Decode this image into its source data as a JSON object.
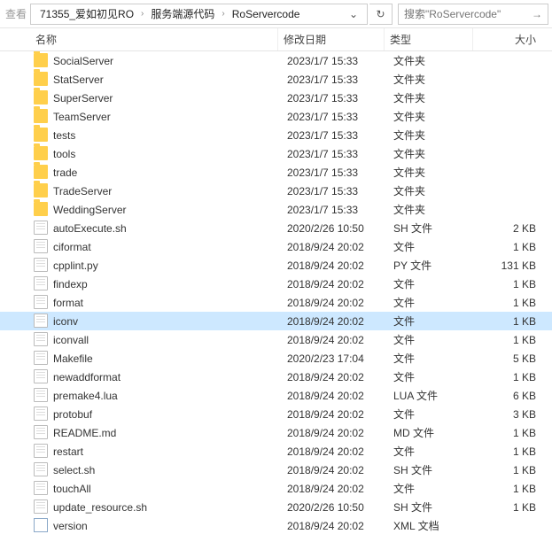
{
  "toolbar": {
    "back_label": "查看",
    "breadcrumb": [
      "71355_爱如初见RO",
      "服务端源代码",
      "RoServercode"
    ],
    "search_placeholder": "搜索\"RoServercode\""
  },
  "columns": {
    "name": "名称",
    "modified": "修改日期",
    "type": "类型",
    "size": "大小"
  },
  "files": [
    {
      "icon": "folder",
      "name": "SocialServer",
      "modified": "2023/1/7 15:33",
      "type": "文件夹",
      "size": ""
    },
    {
      "icon": "folder",
      "name": "StatServer",
      "modified": "2023/1/7 15:33",
      "type": "文件夹",
      "size": ""
    },
    {
      "icon": "folder",
      "name": "SuperServer",
      "modified": "2023/1/7 15:33",
      "type": "文件夹",
      "size": ""
    },
    {
      "icon": "folder",
      "name": "TeamServer",
      "modified": "2023/1/7 15:33",
      "type": "文件夹",
      "size": ""
    },
    {
      "icon": "folder",
      "name": "tests",
      "modified": "2023/1/7 15:33",
      "type": "文件夹",
      "size": ""
    },
    {
      "icon": "folder",
      "name": "tools",
      "modified": "2023/1/7 15:33",
      "type": "文件夹",
      "size": ""
    },
    {
      "icon": "folder",
      "name": "trade",
      "modified": "2023/1/7 15:33",
      "type": "文件夹",
      "size": ""
    },
    {
      "icon": "folder",
      "name": "TradeServer",
      "modified": "2023/1/7 15:33",
      "type": "文件夹",
      "size": ""
    },
    {
      "icon": "folder",
      "name": "WeddingServer",
      "modified": "2023/1/7 15:33",
      "type": "文件夹",
      "size": ""
    },
    {
      "icon": "file",
      "name": "autoExecute.sh",
      "modified": "2020/2/26 10:50",
      "type": "SH 文件",
      "size": "2 KB"
    },
    {
      "icon": "file",
      "name": "ciformat",
      "modified": "2018/9/24 20:02",
      "type": "文件",
      "size": "1 KB"
    },
    {
      "icon": "file",
      "name": "cpplint.py",
      "modified": "2018/9/24 20:02",
      "type": "PY 文件",
      "size": "131 KB"
    },
    {
      "icon": "file",
      "name": "findexp",
      "modified": "2018/9/24 20:02",
      "type": "文件",
      "size": "1 KB"
    },
    {
      "icon": "file",
      "name": "format",
      "modified": "2018/9/24 20:02",
      "type": "文件",
      "size": "1 KB"
    },
    {
      "icon": "file",
      "name": "iconv",
      "modified": "2018/9/24 20:02",
      "type": "文件",
      "size": "1 KB",
      "selected": true
    },
    {
      "icon": "file",
      "name": "iconvall",
      "modified": "2018/9/24 20:02",
      "type": "文件",
      "size": "1 KB"
    },
    {
      "icon": "file",
      "name": "Makefile",
      "modified": "2020/2/23 17:04",
      "type": "文件",
      "size": "5 KB"
    },
    {
      "icon": "file",
      "name": "newaddformat",
      "modified": "2018/9/24 20:02",
      "type": "文件",
      "size": "1 KB"
    },
    {
      "icon": "file",
      "name": "premake4.lua",
      "modified": "2018/9/24 20:02",
      "type": "LUA 文件",
      "size": "6 KB"
    },
    {
      "icon": "file",
      "name": "protobuf",
      "modified": "2018/9/24 20:02",
      "type": "文件",
      "size": "3 KB"
    },
    {
      "icon": "file",
      "name": "README.md",
      "modified": "2018/9/24 20:02",
      "type": "MD 文件",
      "size": "1 KB"
    },
    {
      "icon": "file",
      "name": "restart",
      "modified": "2018/9/24 20:02",
      "type": "文件",
      "size": "1 KB"
    },
    {
      "icon": "file",
      "name": "select.sh",
      "modified": "2018/9/24 20:02",
      "type": "SH 文件",
      "size": "1 KB"
    },
    {
      "icon": "file",
      "name": "touchAll",
      "modified": "2018/9/24 20:02",
      "type": "文件",
      "size": "1 KB"
    },
    {
      "icon": "file",
      "name": "update_resource.sh",
      "modified": "2020/2/26 10:50",
      "type": "SH 文件",
      "size": "1 KB"
    },
    {
      "icon": "xml",
      "name": "version",
      "modified": "2018/9/24 20:02",
      "type": "XML 文档",
      "size": ""
    }
  ]
}
